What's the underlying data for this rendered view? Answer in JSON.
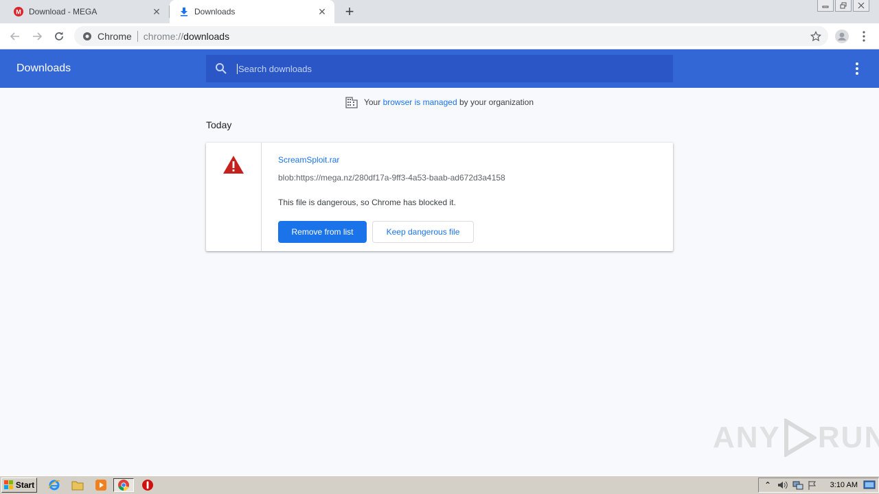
{
  "browser": {
    "tabs": [
      {
        "title": "Download - MEGA",
        "active": false
      },
      {
        "title": "Downloads",
        "active": true
      }
    ],
    "omnibox": {
      "site_label": "Chrome",
      "url_scheme": "chrome://",
      "url_host": "downloads"
    }
  },
  "downloads_page": {
    "title": "Downloads",
    "search": {
      "placeholder": "Search downloads"
    },
    "managed_notice": {
      "prefix": "Your ",
      "link": "browser is managed",
      "suffix": " by your organization"
    },
    "section_date": "Today",
    "items": [
      {
        "file_name": "ScreamSploit.rar",
        "url": "blob:https://mega.nz/280df17a-9ff3-4a53-baab-ad672d3a4158",
        "status": "This file is dangerous, so Chrome has blocked it.",
        "primary_action": "Remove from list",
        "secondary_action": "Keep dangerous file"
      }
    ]
  },
  "watermark": {
    "left": "ANY",
    "right": "RUN"
  },
  "taskbar": {
    "start_label": "Start",
    "clock": "3:10 AM"
  },
  "colors": {
    "header_blue": "#3367d6",
    "search_blue": "#2a56c6",
    "link_blue": "#1a73e8",
    "danger_red": "#c5221f"
  }
}
